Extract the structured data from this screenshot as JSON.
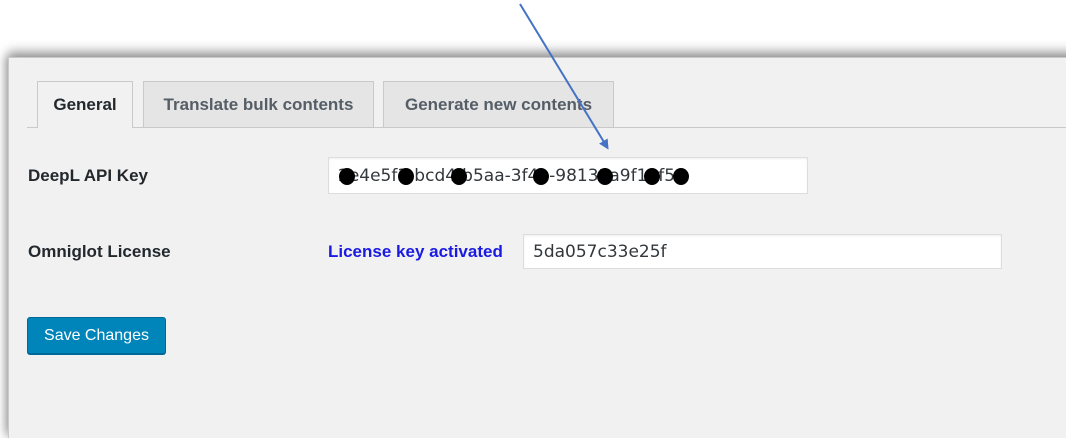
{
  "tabs": [
    {
      "label": "General",
      "active": true
    },
    {
      "label": "Translate bulk contents",
      "active": false
    },
    {
      "label": "Generate new contents",
      "active": false
    }
  ],
  "fields": {
    "deepl": {
      "label": "DeepL API Key",
      "value": "2e4e5f3-bcd4-b5aa-3f4b-98131a9f13f5"
    },
    "omniglot": {
      "label": "Omniglot License",
      "status": "License key activated",
      "value": "5da057c33e25f"
    }
  },
  "actions": {
    "save_label": "Save Changes"
  },
  "colors": {
    "accent": "#0085ba",
    "status": "#1a1ae0",
    "annotation_arrow": "#4472c4"
  }
}
